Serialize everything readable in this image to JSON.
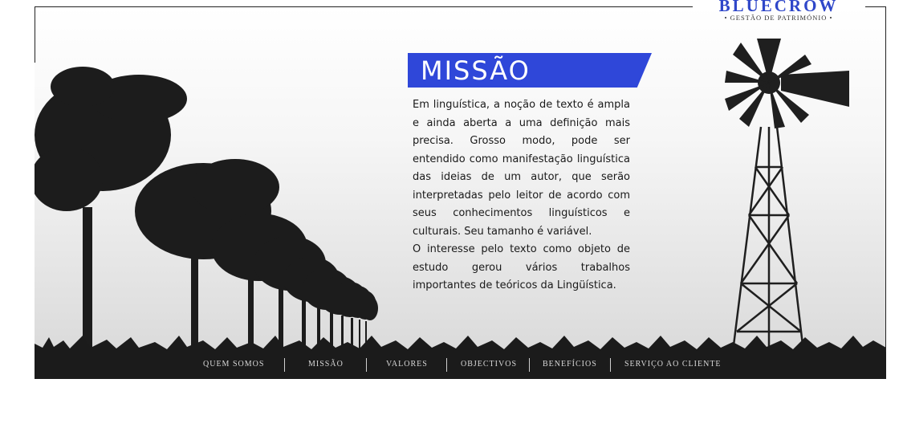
{
  "brand": {
    "name": "BLUECROW",
    "tagline": "• GESTÃO DE PATRIMÓNIO •",
    "color": "#2f47c9"
  },
  "section": {
    "title": "MISSÃO",
    "banner_color": "#2f47d9",
    "paragraphs": [
      "Em linguística, a noção de texto é ampla e ainda aberta a uma definição mais precisa. Grosso modo, pode ser entendido como manifestação linguística das ideias de um autor, que serão interpretadas pelo leitor de acordo com seus conhecimentos linguísticos e culturais. Seu tamanho é variável.",
      "O interesse pelo texto como objeto de estudo gerou vários trabalhos importantes de teóricos da Lingüística."
    ]
  },
  "nav": {
    "items": [
      {
        "label": "QUEM SOMOS"
      },
      {
        "label": "MISSÃO"
      },
      {
        "label": "VALORES"
      },
      {
        "label": "OBJECTIVOS"
      },
      {
        "label": "BENEFÍCIOS"
      },
      {
        "label": "SERVIÇO AO CLIENTE"
      }
    ]
  },
  "icons": [
    "tree-silhouette",
    "windmill-icon",
    "grass-silhouette"
  ]
}
